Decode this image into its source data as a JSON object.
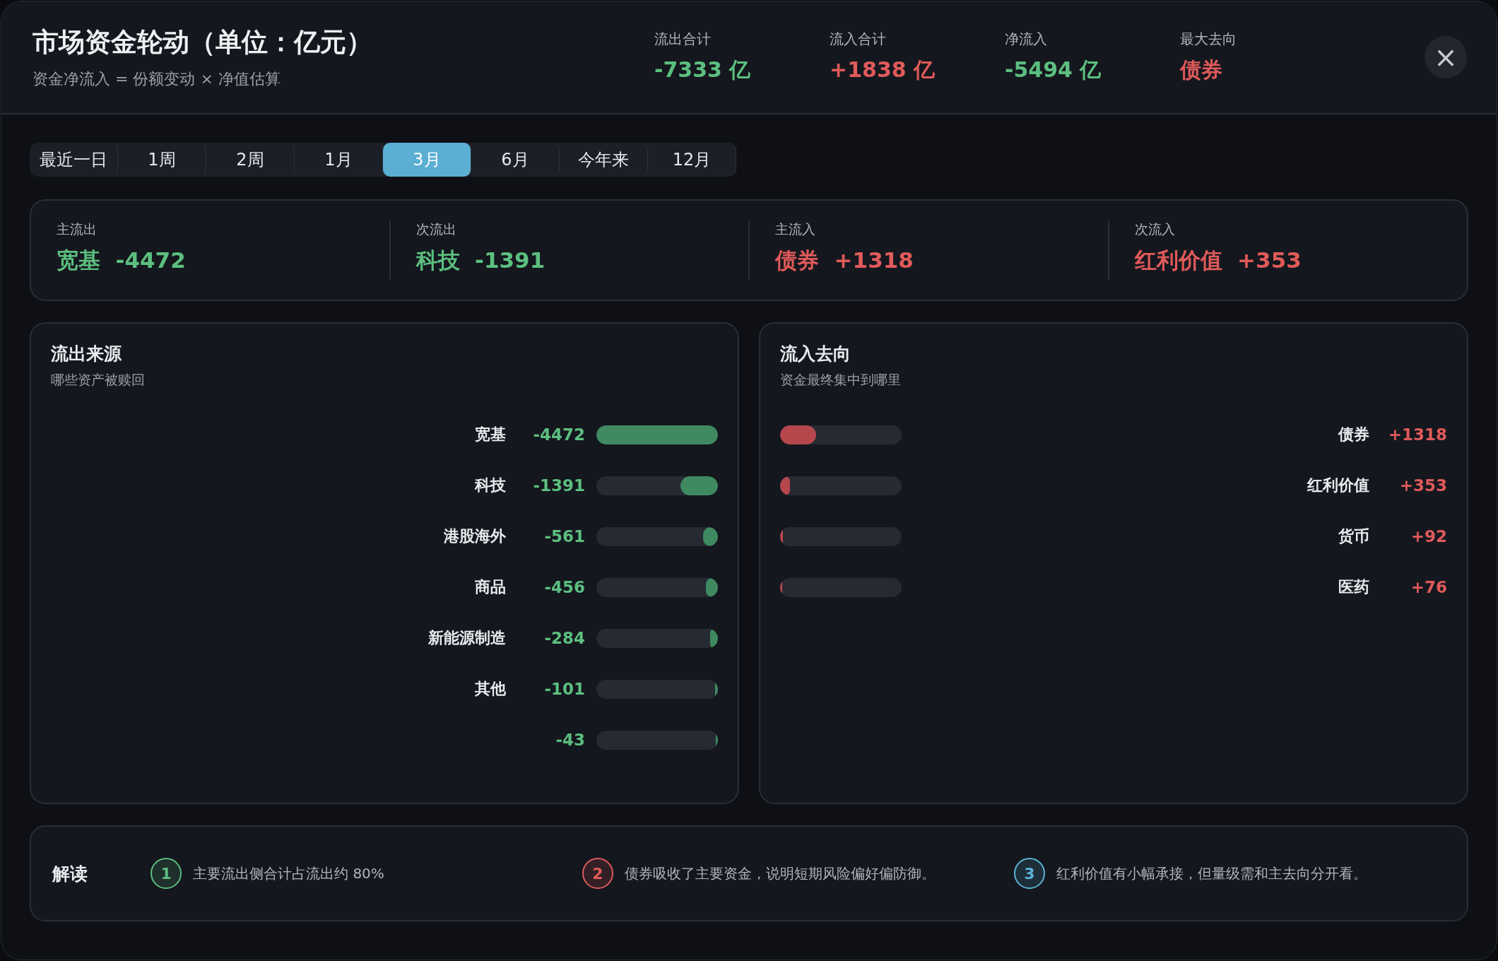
{
  "header": {
    "title": "市场资金轮动（单位：亿元）",
    "subtitle": "资金净流入 = 份额变动 × 净值估算",
    "stats": [
      {
        "label": "流出合计",
        "value": "-7333 亿",
        "color": "#5cbf7f"
      },
      {
        "label": "流入合计",
        "value": "+1838 亿",
        "color": "#e05a5a"
      },
      {
        "label": "净流入",
        "value": "-5494 亿",
        "color": "#5cbf7f"
      },
      {
        "label": "最大去向",
        "value": "债券",
        "color": "#e05a5a"
      }
    ],
    "close": "×"
  },
  "tabs": [
    {
      "label": "最近一日",
      "selected": false
    },
    {
      "label": "1周",
      "selected": false
    },
    {
      "label": "2周",
      "selected": false
    },
    {
      "label": "1月",
      "selected": false
    },
    {
      "label": "3月",
      "selected": true
    },
    {
      "label": "6月",
      "selected": false
    },
    {
      "label": "今年来",
      "selected": false
    },
    {
      "label": "12月",
      "selected": false
    }
  ],
  "summary": [
    {
      "label": "主流出",
      "name": "宽基",
      "value": "-4472",
      "color": "#5cbf7f"
    },
    {
      "label": "次流出",
      "name": "科技",
      "value": "-1391",
      "color": "#5cbf7f"
    },
    {
      "label": "主流入",
      "name": "债券",
      "value": "+1318",
      "color": "#e05a5a"
    },
    {
      "label": "次流入",
      "name": "红利价值",
      "value": "+353",
      "color": "#e05a5a"
    }
  ],
  "outflow": {
    "title": "流出来源",
    "subtitle": "哪些资产被赎回",
    "rows": [
      {
        "name": "宽基",
        "value": "-4472",
        "level": 1.0
      },
      {
        "name": "科技",
        "value": "-1391",
        "level": 0.31
      },
      {
        "name": "港股海外",
        "value": "-561",
        "level": 0.125
      },
      {
        "name": "商品",
        "value": "-456",
        "level": 0.1
      },
      {
        "name": "新能源制造",
        "value": "-284",
        "level": 0.063
      },
      {
        "name": "其他",
        "value": "-101",
        "level": 0.023
      },
      {
        "value": "-43",
        "level": 0.01
      }
    ]
  },
  "inflow": {
    "title": "流入去向",
    "subtitle": "资金最终集中到哪里",
    "rows": [
      {
        "name": "债券",
        "value": "+1318",
        "level": 0.295
      },
      {
        "name": "红利价值",
        "value": "+353",
        "level": 0.079
      },
      {
        "name": "货币",
        "value": "+92",
        "level": 0.021
      },
      {
        "name": "医药",
        "value": "+76",
        "level": 0.017
      }
    ]
  },
  "insights": {
    "title": "解读",
    "items": [
      {
        "number": "1",
        "text": "主要流出侧合计占流出约 80%",
        "color": "#5cbf7f"
      },
      {
        "number": "2",
        "text": "债券吸收了主要资金，说明短期风险偏好偏防御。",
        "color": "#e05a5a"
      },
      {
        "number": "3",
        "text": "红利价值有小幅承接，但量级需和主去向分开看。",
        "color": "#5ab4d6"
      }
    ]
  }
}
